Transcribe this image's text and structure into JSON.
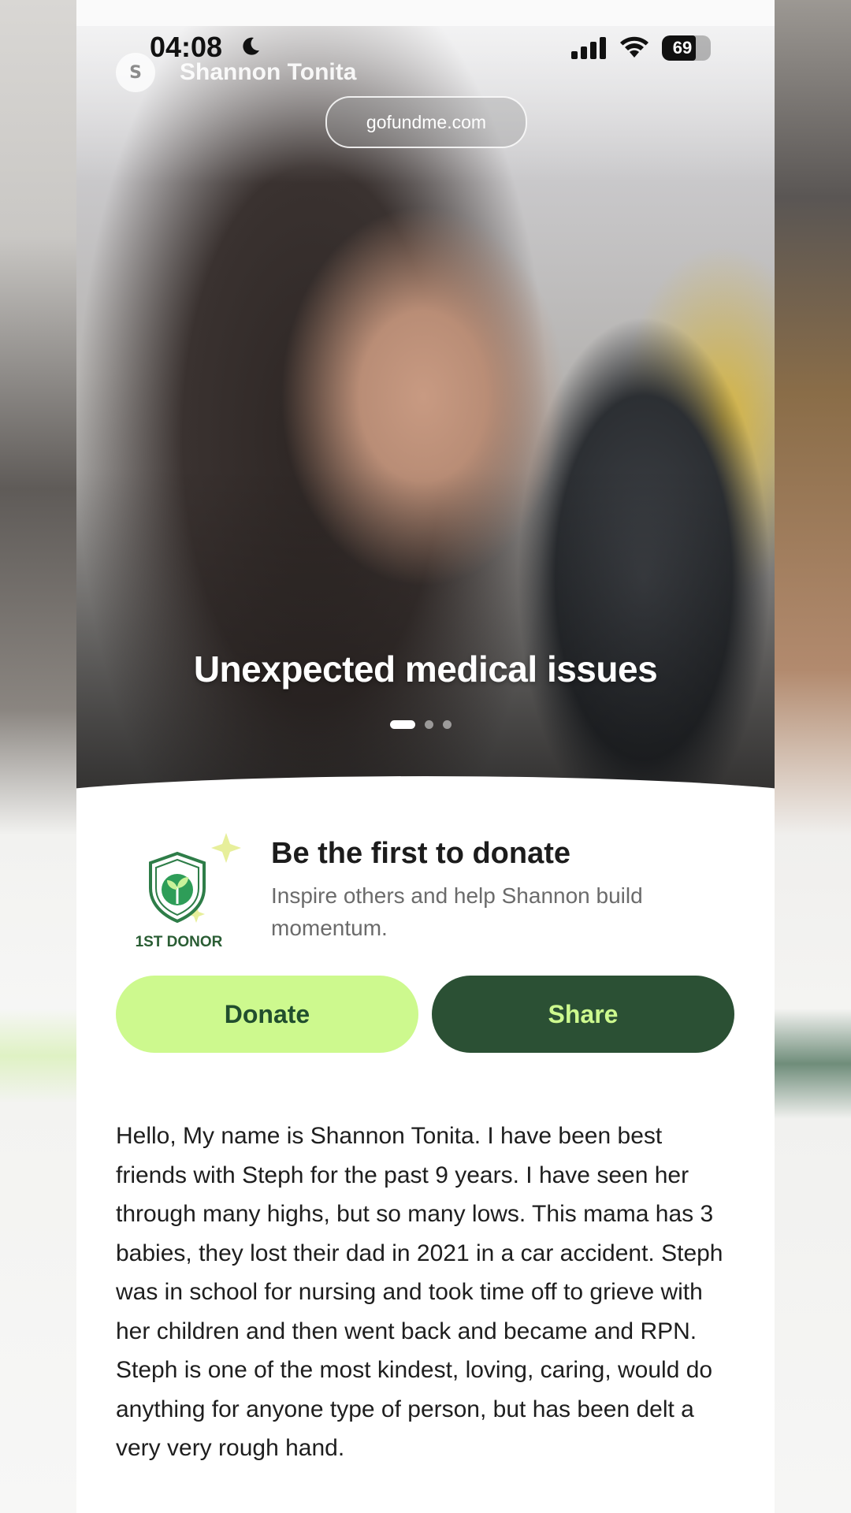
{
  "status_bar": {
    "time": "04:08",
    "battery_level": "69",
    "battery_fraction": 0.69
  },
  "profile": {
    "initial": "S",
    "name": "Shannon Tonita"
  },
  "browser": {
    "url": "gofundme.com"
  },
  "hero": {
    "title": "Unexpected medical issues",
    "slide_count": 3,
    "active_slide": 1
  },
  "donor": {
    "badge_label": "1ST DONOR",
    "title": "Be the first to donate",
    "subtitle": "Inspire others and help Shannon build momentum."
  },
  "actions": {
    "donate_label": "Donate",
    "share_label": "Share"
  },
  "story": {
    "text": "Hello, My name is Shannon Tonita. I have been best friends with Steph for the past 9 years. I have seen her through many highs, but so many lows. This mama has 3 babies, they lost their dad in 2021 in a car accident. Steph was in school for nursing and took time off to grieve with her children and then went back and became and RPN. Steph is one of the most kindest, loving, caring, would do anything for anyone type of person, but has been delt a very very rough hand."
  },
  "colors": {
    "donate_button": "#cdf98e",
    "share_button": "#2b5034",
    "brand_green": "#2a5d34"
  },
  "icons": {
    "moon": "moon-icon",
    "signal": "cellular-signal-icon",
    "wifi": "wifi-icon",
    "battery": "battery-icon",
    "badge": "shield-sprout-icon"
  }
}
